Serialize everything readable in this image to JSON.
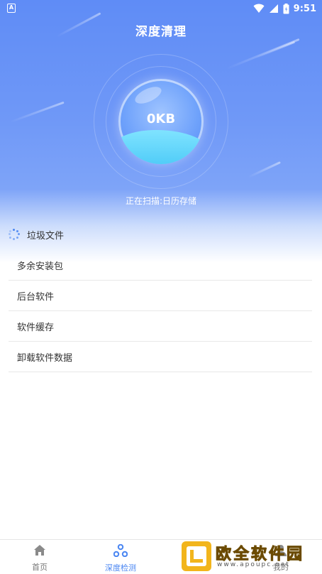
{
  "status_bar": {
    "left_icon": "A",
    "time": "9:51",
    "icons": [
      "wifi-icon",
      "signal-icon",
      "battery-icon"
    ]
  },
  "header": {
    "title": "深度清理"
  },
  "scan": {
    "size_value": "0KB",
    "status_text": "正在扫描:日历存储"
  },
  "junk_section": {
    "title": "垃圾文件",
    "items": [
      {
        "label": "多余安装包"
      },
      {
        "label": "后台软件"
      },
      {
        "label": "软件缓存"
      },
      {
        "label": "卸载软件数据"
      }
    ]
  },
  "bottom_nav": {
    "items": [
      {
        "label": "首页",
        "icon": "home-icon",
        "active": false
      },
      {
        "label": "深度检测",
        "icon": "deep-scan-icon",
        "active": true
      },
      {
        "label": "",
        "icon": "tool-icon",
        "active": false
      },
      {
        "label": "我的",
        "icon": "user-icon",
        "active": false
      }
    ]
  },
  "watermark": {
    "text": "欧全软件园",
    "url": "www.apoupc.net"
  },
  "colors": {
    "accent": "#4a86f2",
    "header_gradient_top": "#5f8cf6",
    "water": "#46c7f6",
    "watermark_yellow": "#f2b51c"
  }
}
